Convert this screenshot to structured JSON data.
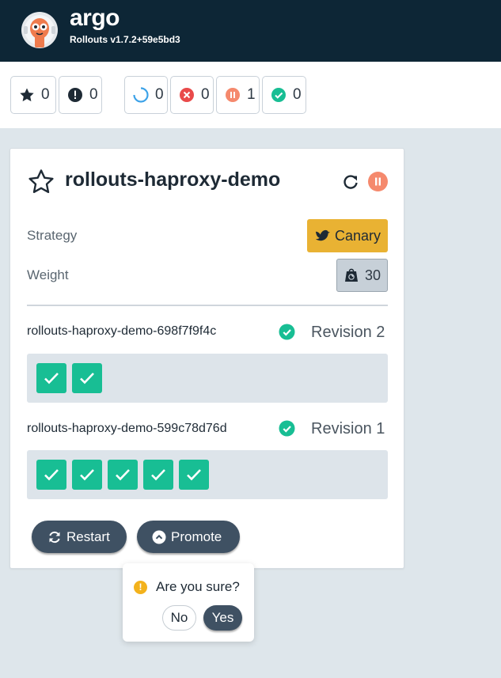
{
  "header": {
    "brand": "argo",
    "version": "Rollouts v1.7.2+59e5bd3"
  },
  "toolbar": {
    "favorites_count": "0",
    "needs_attention_count": "0",
    "progressing_count": "0",
    "degraded_count": "0",
    "paused_count": "1",
    "healthy_count": "0"
  },
  "rollout": {
    "name": "rollouts-haproxy-demo",
    "strategy_label": "Strategy",
    "strategy_value": "Canary",
    "weight_label": "Weight",
    "weight_value": "30",
    "replica_sets": [
      {
        "name": "rollouts-haproxy-demo-698f7f9f4c",
        "revision": "Revision 2",
        "pod_count": 2
      },
      {
        "name": "rollouts-haproxy-demo-599c78d76d",
        "revision": "Revision 1",
        "pod_count": 5
      }
    ],
    "restart_label": "Restart",
    "promote_label": "Promote"
  },
  "confirm": {
    "icon_text": "!",
    "question": "Are you sure?",
    "no_label": "No",
    "yes_label": "Yes"
  },
  "colors": {
    "header_bg": "#0d2636",
    "healthy": "#18be94",
    "paused": "#f5896d",
    "canary": "#e9b233",
    "button": "#3f5163"
  }
}
